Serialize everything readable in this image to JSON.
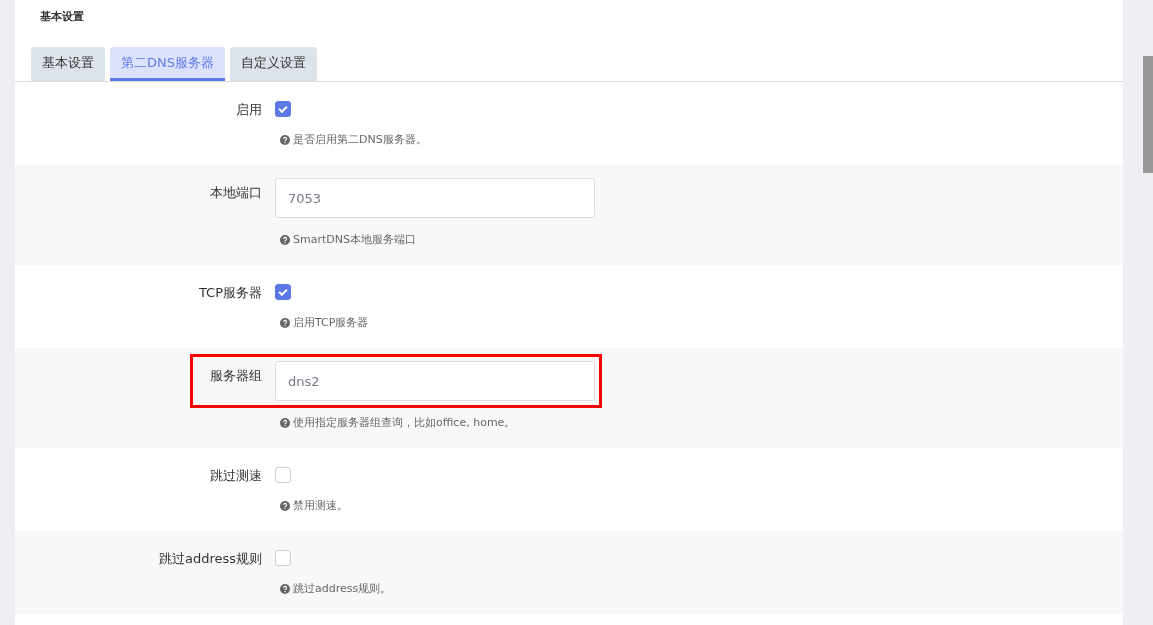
{
  "section_title": "基本设置",
  "tabs": [
    {
      "label": "基本设置",
      "selected": false
    },
    {
      "label": "第二DNS服务器",
      "selected": true
    },
    {
      "label": "自定义设置",
      "selected": false
    }
  ],
  "rows": [
    {
      "kind": "checkbox",
      "label": "启用",
      "checked": true,
      "help": "是否启用第二DNS服务器。",
      "highlighted": false
    },
    {
      "kind": "text",
      "label": "本地端口",
      "value": "7053",
      "help": "SmartDNS本地服务端口",
      "highlighted": false
    },
    {
      "kind": "checkbox",
      "label": "TCP服务器",
      "checked": true,
      "help": "启用TCP服务器",
      "highlighted": false
    },
    {
      "kind": "text",
      "label": "服务器组",
      "value": "dns2",
      "help": "使用指定服务器组查询，比如office, home。",
      "highlighted": true
    },
    {
      "kind": "checkbox",
      "label": "跳过测速",
      "checked": false,
      "help": "禁用测速。",
      "highlighted": false
    },
    {
      "kind": "checkbox",
      "label": "跳过address规则",
      "checked": false,
      "help": "跳过address规则。",
      "highlighted": false
    }
  ]
}
